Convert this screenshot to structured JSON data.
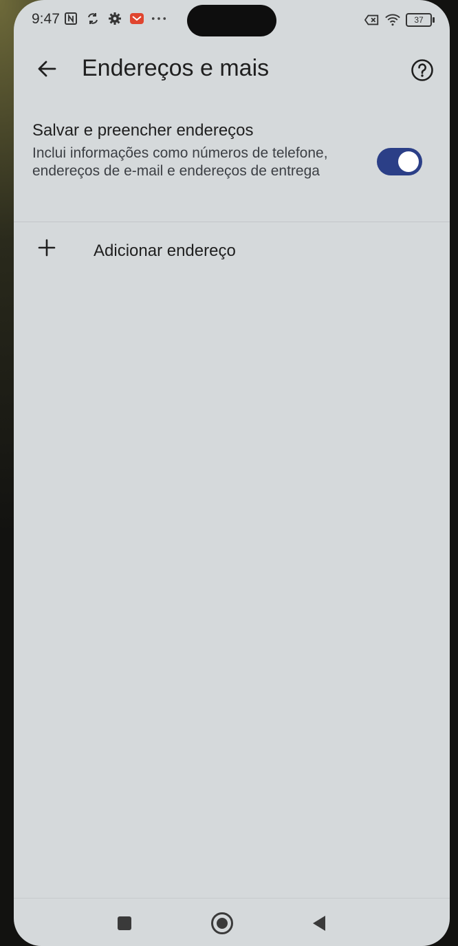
{
  "status_bar": {
    "time": "9:47",
    "battery": "37",
    "icons_left": [
      "nfc-icon",
      "sync-icon",
      "settings-icon",
      "mail-notification-icon",
      "more-dots-icon"
    ],
    "icons_right": [
      "battery-saver-icon",
      "wifi-icon",
      "battery-icon"
    ],
    "notification_color": "#e0452f"
  },
  "app_bar": {
    "title": "Endereços e mais",
    "back_icon": "arrow-left-icon",
    "help_icon": "help-circle-icon"
  },
  "setting": {
    "title": "Salvar e preencher endereços",
    "description": "Inclui informações como números de telefone, endereços de e-mail e endereços de entrega",
    "toggle_on": true,
    "toggle_color": "#2b3f87"
  },
  "add_address": {
    "label": "Adicionar endereço",
    "icon": "plus-icon"
  },
  "nav_bar": {
    "buttons": [
      "recents-square-icon",
      "home-circle-icon",
      "back-triangle-icon"
    ]
  }
}
